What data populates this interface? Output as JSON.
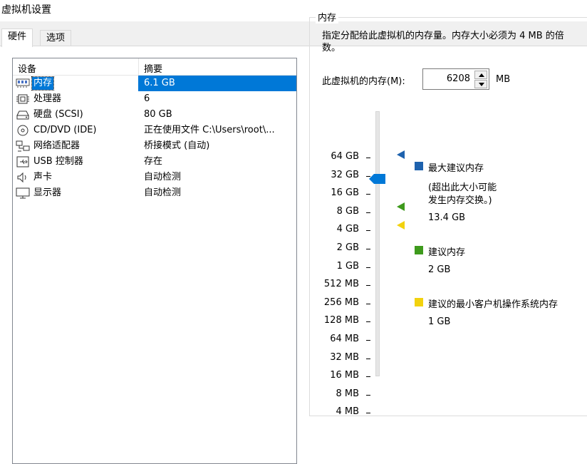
{
  "window": {
    "title": "虚拟机设置"
  },
  "tabs": {
    "hardware": "硬件",
    "options": "选项"
  },
  "device_list": {
    "headers": {
      "device": "设备",
      "summary": "摘要"
    },
    "rows": [
      {
        "name": "内存",
        "summary": "6.1 GB",
        "icon": "memory-icon"
      },
      {
        "name": "处理器",
        "summary": "6",
        "icon": "cpu-icon"
      },
      {
        "name": "硬盘 (SCSI)",
        "summary": "80 GB",
        "icon": "hard-disk-icon"
      },
      {
        "name": "CD/DVD (IDE)",
        "summary": "正在使用文件 C:\\Users\\root\\...",
        "icon": "cd-dvd-icon"
      },
      {
        "name": "网络适配器",
        "summary": "桥接模式 (自动)",
        "icon": "network-adapter-icon"
      },
      {
        "name": "USB 控制器",
        "summary": "存在",
        "icon": "usb-icon"
      },
      {
        "name": "声卡",
        "summary": "自动检测",
        "icon": "sound-card-icon"
      },
      {
        "name": "显示器",
        "summary": "自动检测",
        "icon": "monitor-icon"
      }
    ]
  },
  "memory": {
    "group_title": "内存",
    "description": "指定分配给此虚拟机的内存量。内存大小必须为 4 MB 的倍数。",
    "field_label": "此虚拟机的内存(M):",
    "value": "6208",
    "unit": "MB",
    "scale_labels": [
      "64 GB",
      "32 GB",
      "16 GB",
      "8 GB",
      "4 GB",
      "2 GB",
      "1 GB",
      "512 MB",
      "256 MB",
      "128 MB",
      "64 MB",
      "32 MB",
      "16 MB",
      "8 MB",
      "4 MB"
    ],
    "legend": {
      "max_recommended_title": "最大建议内存",
      "max_recommended_note_1": "(超出此大小可能",
      "max_recommended_note_2": "发生内存交换。)",
      "max_recommended_value": "13.4 GB",
      "recommended_title": "建议内存",
      "recommended_value": "2 GB",
      "min_guest_title": "建议的最小客户机操作系统内存",
      "min_guest_value": "1 GB"
    },
    "colors": {
      "max_recommended": "#1e62ae",
      "recommended": "#3e9a1c",
      "min_guest": "#f2d20e",
      "thumb": "#0078d7"
    }
  }
}
